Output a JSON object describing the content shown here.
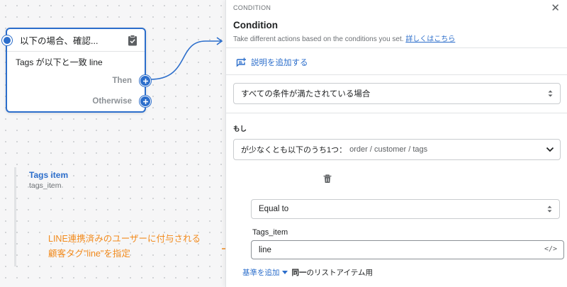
{
  "node": {
    "title": "以下の場合、確認...",
    "condition": "Tags が以下と一致 line",
    "then_label": "Then",
    "otherwise_label": "Otherwise"
  },
  "annotation": {
    "line1": "LINE連携済みのユーザーに付与される",
    "line2": "顧客タグ\"line\"を指定",
    "color": "#f28a1c"
  },
  "panel": {
    "kicker": "CONDITION",
    "close": "✕",
    "title": "Condition",
    "description": "Take different actions based on the conditions you set.",
    "learn_more": "詳しくはこちら",
    "add_description": "説明を追加する",
    "match_select": "すべての条件が満たされている場合",
    "if_label": "もし",
    "accordion": {
      "prefix": "が少なくとも以下のうち1つ：",
      "path": "order / customer / tags"
    },
    "item": {
      "title": "Tags item",
      "subtitle": "tags_item",
      "operator": "Equal to",
      "field_label": "Tags_item",
      "value": "line",
      "code_toggle": "</>"
    },
    "footer": {
      "add_criteria": "基準を追加",
      "same_prefix": "同一",
      "same_suffix": "のリストアイテム用"
    }
  },
  "colors": {
    "accent": "#2c6ecb",
    "annotation": "#f28a1c"
  }
}
